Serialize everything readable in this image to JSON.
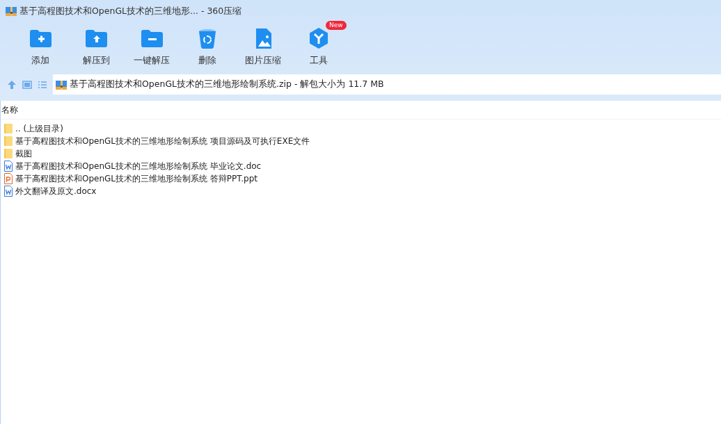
{
  "window": {
    "title": "基于高程图技术和OpenGL技术的三维地形... - 360压缩"
  },
  "toolbar": [
    {
      "kind": "add",
      "label": "添加"
    },
    {
      "kind": "extract-to",
      "label": "解压到"
    },
    {
      "kind": "extract",
      "label": "一键解压"
    },
    {
      "kind": "delete",
      "label": "删除"
    },
    {
      "kind": "image",
      "label": "图片压缩"
    },
    {
      "kind": "tools",
      "label": "工具",
      "badge": "New"
    }
  ],
  "address": {
    "text": "基于高程图技术和OpenGL技术的三维地形绘制系统.zip - 解包大小为 11.7 MB"
  },
  "table": {
    "columns": [
      "名称"
    ],
    "rows": [
      {
        "kind": "folder",
        "name": ".. (上级目录)"
      },
      {
        "kind": "folder",
        "name": "基于高程图技术和OpenGL技术的三维地形绘制系统 项目源码及可执行EXE文件"
      },
      {
        "kind": "folder",
        "name": "截图"
      },
      {
        "kind": "word",
        "name": "基于高程图技术和OpenGL技术的三维地形绘制系统 毕业论文.doc"
      },
      {
        "kind": "ppt",
        "name": "基于高程图技术和OpenGL技术的三维地形绘制系统 答辩PPT.ppt"
      },
      {
        "kind": "word",
        "name": "外文翻译及原文.docx"
      }
    ]
  }
}
